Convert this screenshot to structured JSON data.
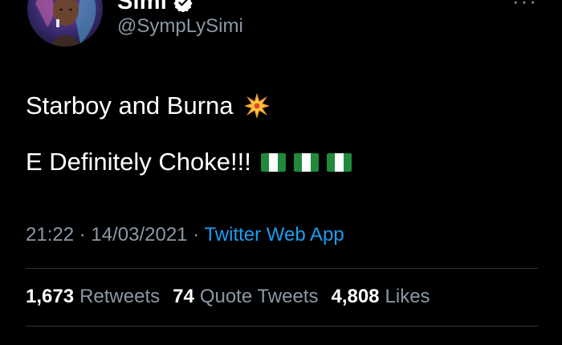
{
  "author": {
    "display_name": "Simi",
    "handle": "@SympLySimi",
    "verified": true,
    "avatar_icon": "profile-avatar"
  },
  "tweet": {
    "line1": "Starboy and Burna",
    "line1_emoji": "collision-emoji",
    "line2": "E Definitely Choke!!!",
    "line2_emoji": [
      "nigeria-flag",
      "nigeria-flag",
      "nigeria-flag"
    ]
  },
  "meta": {
    "time": "21:22",
    "separator": "·",
    "date": "14/03/2021",
    "source": "Twitter Web App"
  },
  "stats": {
    "retweets_count": "1,673",
    "retweets_label": "Retweets",
    "quotes_count": "74",
    "quotes_label": "Quote Tweets",
    "likes_count": "4,808",
    "likes_label": "Likes"
  },
  "colors": {
    "background": "#000000",
    "text": "#ffffff",
    "secondary": "#8b98a5",
    "link": "#1d9bf0",
    "divider": "#2f3336"
  }
}
